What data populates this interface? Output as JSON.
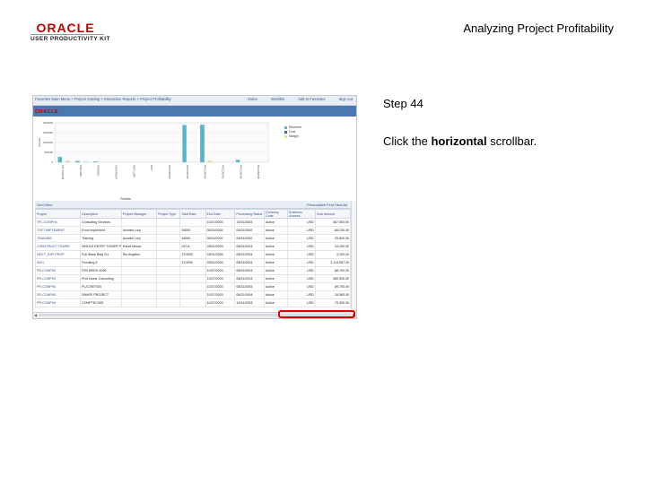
{
  "header": {
    "logo_brand": "ORACLE",
    "logo_subtitle": "USER PRODUCTIVITY KIT",
    "doc_title": "Analyzing Project Profitability"
  },
  "instruction": {
    "step": "Step 44",
    "text_before": "Click the ",
    "text_bold": "horizontal",
    "text_after": " scrollbar."
  },
  "screenshot": {
    "breadcrumb": "Favorites   Main Menu   > Project Costing > Interactive Reports > Project Profitability",
    "toplinks": [
      "Home",
      "Worklist",
      "Add to Favorites",
      "Sign out"
    ],
    "brand": "ORACLE",
    "grid": {
      "title": "Grid View",
      "right": "Personalize   Find   View All",
      "columns": [
        "Project",
        "Description",
        "Project Manager",
        "Project Type",
        "Start Date",
        "End Date",
        "Processing Status",
        "Currency Code",
        "Business Amount",
        "Cost Amount"
      ],
      "rows": [
        [
          "TFL-CONPH4",
          "Consulting Services",
          "",
          "",
          "",
          "10/27/2003",
          "10/31/2003",
          "Active",
          "USD",
          "467,500.00"
        ],
        [
          "TOFT-IMPLEMENT",
          "Food Implement",
          "Anneke Lizp",
          "",
          "34000",
          "05/24/2002",
          "05/31/2002",
          "Active",
          "USD",
          "68,230.00"
        ],
        [
          "TRAINING",
          "Training",
          "Anneke Lizp",
          "",
          "34000",
          "05/24/2002",
          "05/31/2002",
          "Active",
          "USD",
          "29,500.00"
        ],
        [
          "CONSTRUCT TOWER",
          "WHOLE ENTRY TOWER PROJ",
          "Randi Meola",
          "",
          "2471L",
          "03/01/2003",
          "08/31/2004",
          "Active",
          "USD",
          "34,250.00"
        ],
        [
          "NEXT_JUPI PROP",
          "Full Stack Bldg 2/4",
          "Rio Angelos",
          "",
          "TZ4000",
          "03/01/2004",
          "08/31/2004",
          "Active",
          "USD",
          "3,200.00"
        ],
        [
          "0001",
          "Fiscaling #",
          "",
          "",
          "TZ4000",
          "03/01/2004",
          "08/31/2004",
          "Active",
          "USD",
          "2,114,567.00"
        ],
        [
          "PR-CONPH3",
          "P2H BRDG 4099",
          "",
          "",
          "",
          "10/27/2003",
          "08/31/2004",
          "Active",
          "USD",
          "88,700.00"
        ],
        [
          "PR-CONPH3",
          "Prof Linear Consulting",
          "",
          "",
          "",
          "10/27/2003",
          "08/31/2004",
          "Active",
          "USD",
          "460,500.00"
        ],
        [
          "PR-CONPH3",
          "PL/CONT004",
          "",
          "",
          "",
          "10/27/2003",
          "08/31/2004",
          "Active",
          "USD",
          "89,700.00"
        ],
        [
          "PR-CONPH3",
          "SHAPE PROJECT",
          "",
          "",
          "",
          "10/27/2003",
          "08/31/2004",
          "Active",
          "USD",
          "18,560.00"
        ],
        [
          "PR-CONPH4",
          "CONPTECH09",
          "",
          "",
          "",
          "10/27/2003",
          "10/31/2003",
          "Active",
          "USD",
          "79,300.00"
        ]
      ]
    }
  },
  "chart_data": {
    "type": "bar",
    "title": "",
    "xlabel": "Projects",
    "ylabel": "Amount",
    "yticks": [
      "0",
      "500000",
      "1000000",
      "1500000",
      "2000000"
    ],
    "ylim": [
      0,
      2000000
    ],
    "categories": [
      "TFL-CONPH4",
      "TOFT-IMPL",
      "TRAINING",
      "CONSTRUCT",
      "NEXT_JUPI",
      "0001",
      "PR-CONPH3",
      "PR-CONPH3",
      "PR-CONPH3",
      "PR-CONPH3",
      "PR-CONPH4",
      "PR-CONPH5"
    ],
    "series": [
      {
        "name": "Revenue",
        "color": "#4fb8c9",
        "values": [
          260000,
          60000,
          30000,
          0,
          0,
          0,
          0,
          0,
          1890000,
          0,
          0,
          0
        ]
      },
      {
        "name": "Cost",
        "color": "#3a6fa8",
        "values": [
          0,
          0,
          0,
          0,
          0,
          0,
          0,
          0,
          0,
          0,
          0,
          0
        ]
      },
      {
        "name": "Margin",
        "color": "#e4e48a",
        "values": [
          60000,
          20000,
          0,
          0,
          0,
          0,
          0,
          0,
          70000,
          0,
          0,
          0
        ]
      }
    ],
    "extra_bars": [
      {
        "category_index": 7,
        "values": [
          1890000,
          0,
          0
        ]
      },
      {
        "category_index": 8,
        "values": [
          1890000,
          0,
          90000
        ]
      },
      {
        "category_index": 10,
        "values": [
          120000,
          0,
          0
        ]
      }
    ],
    "legend": "right"
  }
}
